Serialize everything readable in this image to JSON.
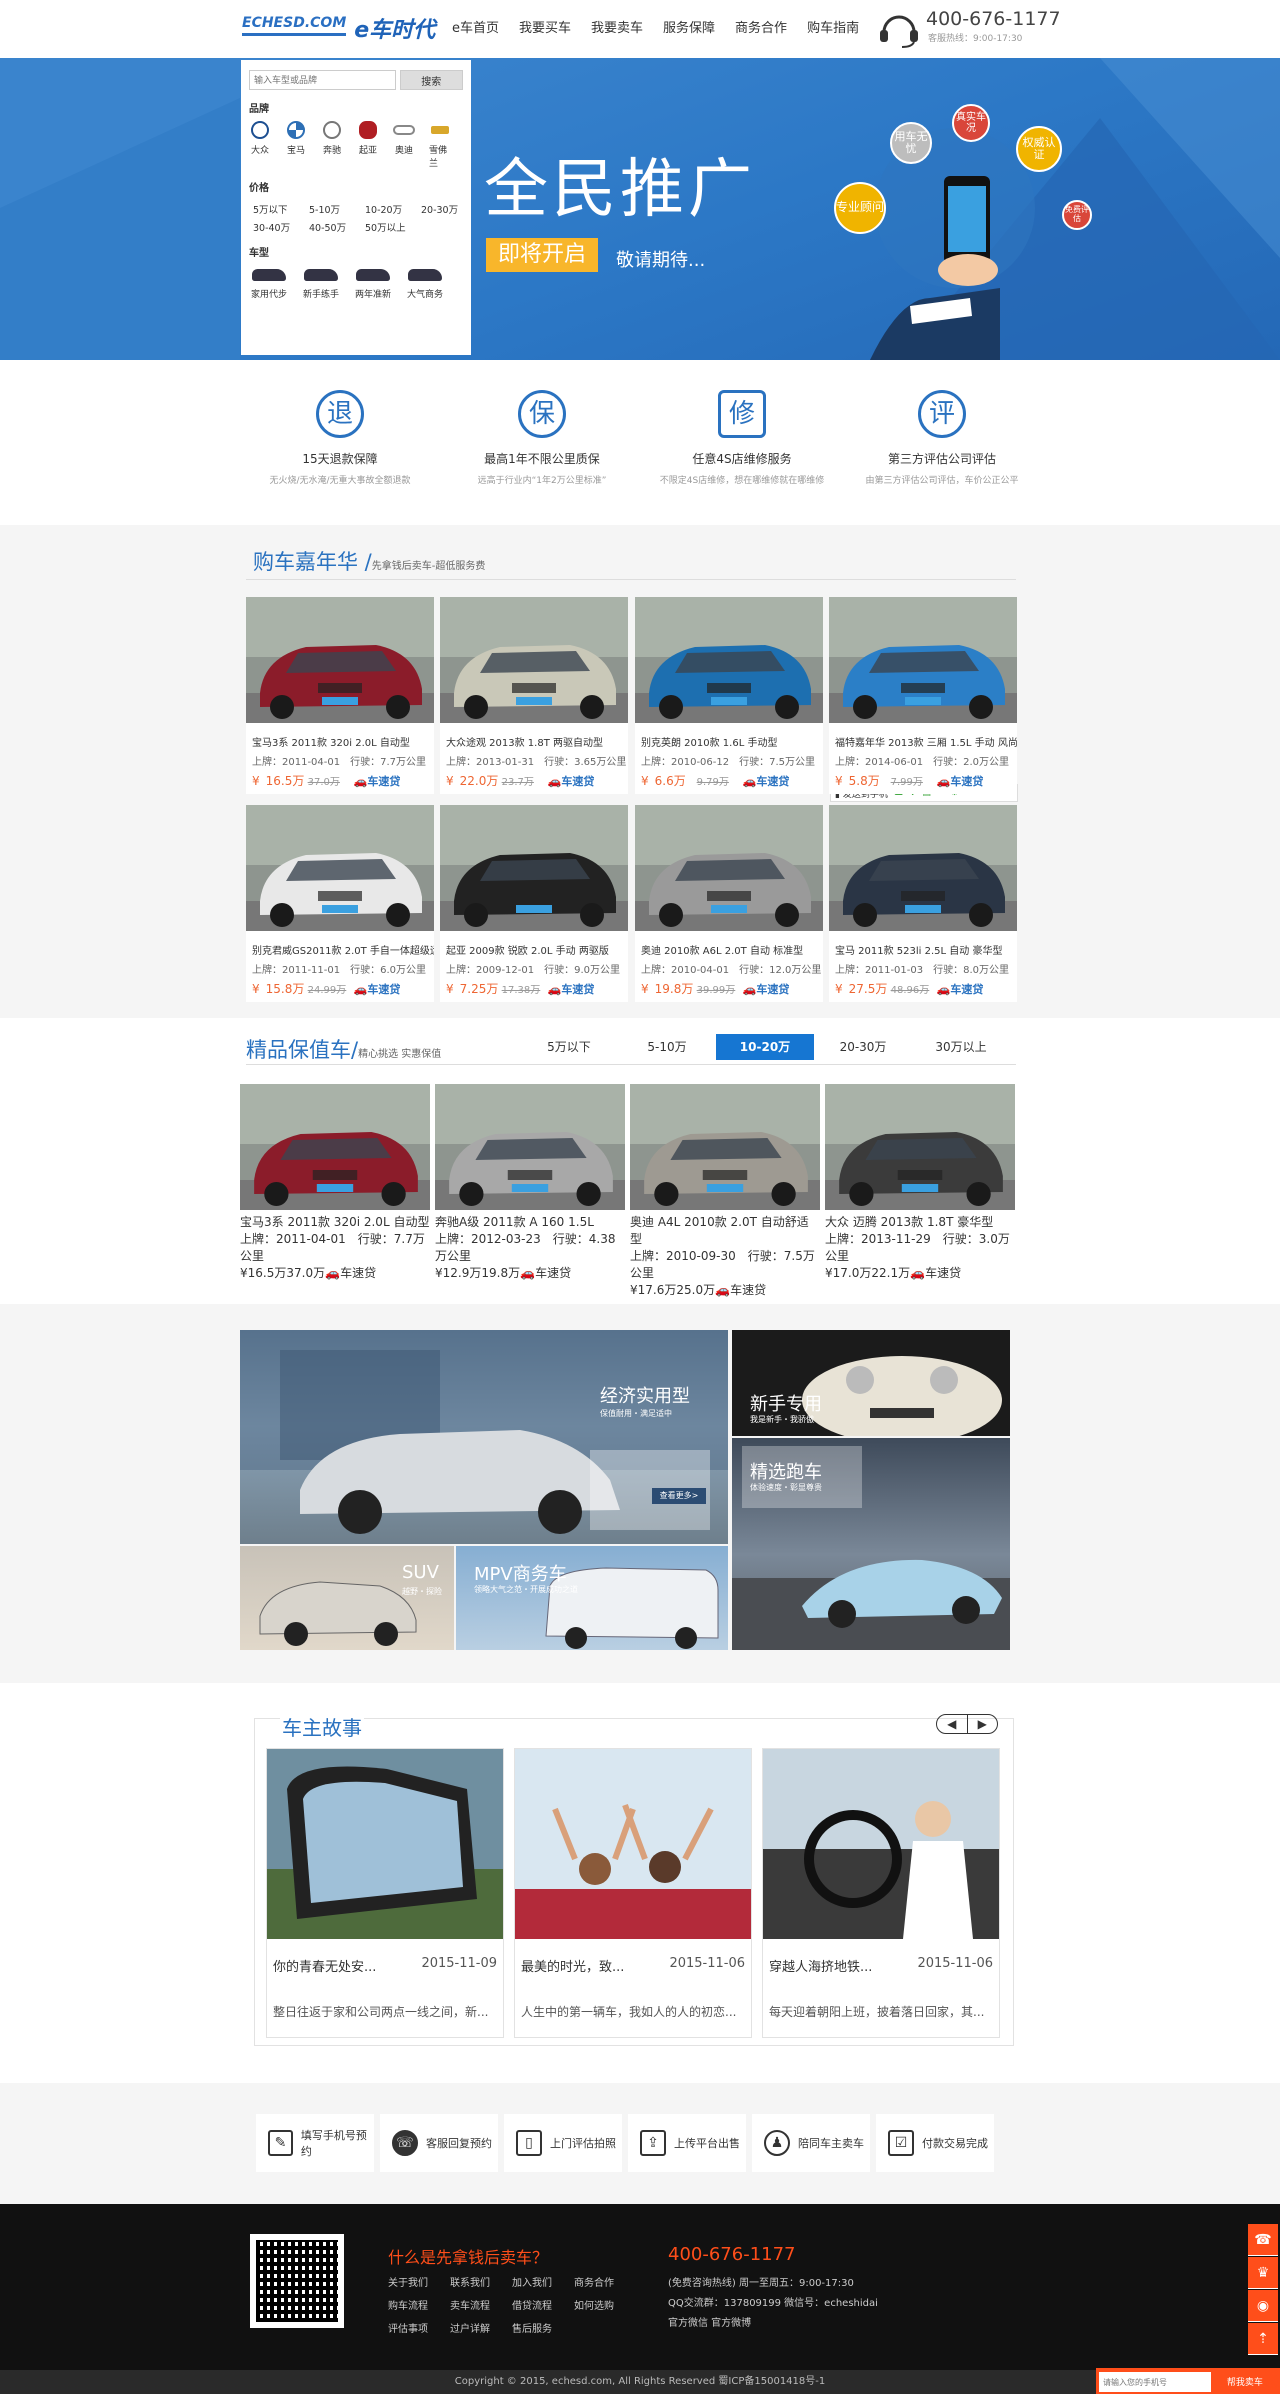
{
  "header": {
    "logo_en": "ECHESD.COM",
    "logo_cn": "e车时代",
    "nav": [
      "e车首页",
      "我要买车",
      "我要卖车",
      "服务保障",
      "商务合作",
      "购车指南"
    ],
    "phone": "400-676-1177",
    "phone_sub": "客服热线：9:00-17:30"
  },
  "filter": {
    "search_placeholder": "输入车型或品牌",
    "search_button": "搜索",
    "brand_title": "品牌",
    "brands": [
      "大众",
      "宝马",
      "奔驰",
      "起亚",
      "奥迪",
      "雪佛兰"
    ],
    "price_title": "价格",
    "prices": [
      "5万以下",
      "5-10万",
      "10-20万",
      "20-30万",
      "30-40万",
      "40-50万",
      "50万以上"
    ],
    "type_title": "车型",
    "types": [
      "家用代步",
      "新手练手",
      "两年准新",
      "大气商务"
    ]
  },
  "banner": {
    "title": "全民推广",
    "button": "即将开启",
    "sub": "敬请期待...",
    "bubbles": [
      "用车无忧",
      "真实车况",
      "权威认证",
      "专业顾问",
      "免费评估"
    ]
  },
  "features": [
    {
      "icon": "退",
      "title": "15天退款保障",
      "desc": "无火烧/无水淹/无重大事故全额退款"
    },
    {
      "icon": "保",
      "title": "最高1年不限公里质保",
      "desc": "远高于行业内“1年2万公里标准”"
    },
    {
      "icon": "修",
      "title": "任意4S店维修服务",
      "desc": "不限定4S店维修，想在哪维修就在哪维修"
    },
    {
      "icon": "评",
      "title": "第三方评估公司评估",
      "desc": "由第三方评估公司评估，车价公正公平"
    }
  ],
  "carnival": {
    "title": "购车嘉年华 /",
    "sub": "先拿钱后卖车-超低服务费",
    "loan_label": "车速贷",
    "send_label": "发送到手机",
    "cars": [
      {
        "title": "宝马3系 2011款 320i 2.0L 自动型",
        "reg": "上牌：2011-04-01",
        "km": "行驶：7.7万公里",
        "price": "16.5万",
        "old": "37.0万",
        "color": "#8b1c2a"
      },
      {
        "title": "大众途观 2013款 1.8T 两驱自动型",
        "reg": "上牌：2013-01-31",
        "km": "行驶：3.65万公里",
        "price": "22.0万",
        "old": "23.7万",
        "color": "#c9c8b8"
      },
      {
        "title": "别克英朗 2010款 1.6L 手动型",
        "reg": "上牌：2010-06-12",
        "km": "行驶：7.5万公里",
        "price": "6.6万",
        "old": "9.79万",
        "color": "#1d6fb0"
      },
      {
        "title": "福特嘉年华 2013款 三厢 1.5L 手动 风尚型",
        "reg": "上牌：2014-06-01",
        "km": "行驶：2.0万公里",
        "price": "5.8万",
        "old": "7.99万",
        "color": "#2b7fc7"
      },
      {
        "title": "别克君威GS2011款 2.0T 手自一体超级运动版",
        "reg": "上牌：2011-11-01",
        "km": "行驶：6.0万公里",
        "price": "15.8万",
        "old": "24.99万",
        "color": "#e8e8e8"
      },
      {
        "title": "起亚 2009款 锐欧 2.0L 手动 两驱版",
        "reg": "上牌：2009-12-01",
        "km": "行驶：9.0万公里",
        "price": "7.25万",
        "old": "17.38万",
        "color": "#222"
      },
      {
        "title": "奥迪 2010款 A6L 2.0T 自动 标准型",
        "reg": "上牌：2010-04-01",
        "km": "行驶：12.0万公里",
        "price": "19.8万",
        "old": "39.99万",
        "color": "#9a9a9a"
      },
      {
        "title": "宝马 2011款 523li 2.5L 自动 豪华型",
        "reg": "上牌：2011-01-03",
        "km": "行驶：8.0万公里",
        "price": "27.5万",
        "old": "48.96万",
        "color": "#2a3545"
      }
    ]
  },
  "quality": {
    "title": "精品保值车/",
    "sub": "精心挑选 实惠保值",
    "tabs": [
      "5万以下",
      "5-10万",
      "10-20万",
      "20-30万",
      "30万以上"
    ],
    "active_tab": "10-20万",
    "cars": [
      {
        "title": "宝马3系 2011款 320i 2.0L 自动型",
        "reg": "上牌：2011-04-01",
        "km": "行驶：7.7万公里",
        "price": "16.5万",
        "old": "37.0万",
        "color": "#8b1c2a"
      },
      {
        "title": "奔驰A级 2011款 A 160 1.5L",
        "reg": "上牌：2012-03-23",
        "km": "行驶：4.38万公里",
        "price": "12.9万",
        "old": "19.8万",
        "color": "#a8a8a8"
      },
      {
        "title": "奥迪 A4L 2010款 2.0T 自动舒适型",
        "reg": "上牌：2010-09-30",
        "km": "行驶：7.5万公里",
        "price": "17.6万",
        "old": "25.0万",
        "color": "#9e9a92"
      },
      {
        "title": "大众 迈腾 2013款 1.8T 豪华型",
        "reg": "上牌：2013-11-29",
        "km": "行驶：3.0万公里",
        "price": "17.0万",
        "old": "22.1万",
        "color": "#3b3b3b"
      }
    ]
  },
  "categories": {
    "economy": {
      "title": "经济实用型",
      "sub": "保值耐用・满足适中",
      "more": "查看更多>"
    },
    "beginner": {
      "title": "新手专用",
      "sub": "我是新手・我骄傲"
    },
    "sport": {
      "title": "精选跑车",
      "sub": "体验速度・彰显尊贵"
    },
    "suv": {
      "title": "SUV",
      "sub": "越野・探险"
    },
    "mpv": {
      "title": "MPV商务车",
      "sub": "领略大气之范・开展成功之道"
    }
  },
  "stories": {
    "title": "车主故事",
    "items": [
      {
        "title": "你的青春无处安...",
        "date": "2015-11-09",
        "excerpt": "整日往返于家和公司两点一线之间，新..."
      },
      {
        "title": "最美的时光，致...",
        "date": "2015-11-06",
        "excerpt": "人生中的第一辆车，我如人的人的初恋..."
      },
      {
        "title": "穿越人海挤地铁...",
        "date": "2015-11-06",
        "excerpt": "每天迎着朝阳上班，披着落日回家，其..."
      }
    ]
  },
  "process": [
    "填写手机号预约",
    "客服回复预约",
    "上门评估拍照",
    "上传平台出售",
    "陪同车主卖车",
    "付款交易完成"
  ],
  "footer": {
    "title": "什么是先拿钱后卖车？",
    "links": [
      "关于我们",
      "联系我们",
      "加入我们",
      "商务合作",
      "购车流程",
      "卖车流程",
      "借贷流程",
      "如何选购",
      "评估事项",
      "过户详解",
      "售后服务"
    ],
    "phone": "400-676-1177",
    "hours": "(免费咨询热线) 周一至周五：9:00-17:30",
    "contact": "QQ交流群：137809199    微信号：echeshidai",
    "social": "官方微信    官方微博",
    "copyright": "Copyright © 2015, echesd.com, All Rights Reserved 蜀ICP备15001418号-1",
    "subscribe_placeholder": "请输入您的手机号",
    "subscribe_button": "帮我卖车"
  }
}
